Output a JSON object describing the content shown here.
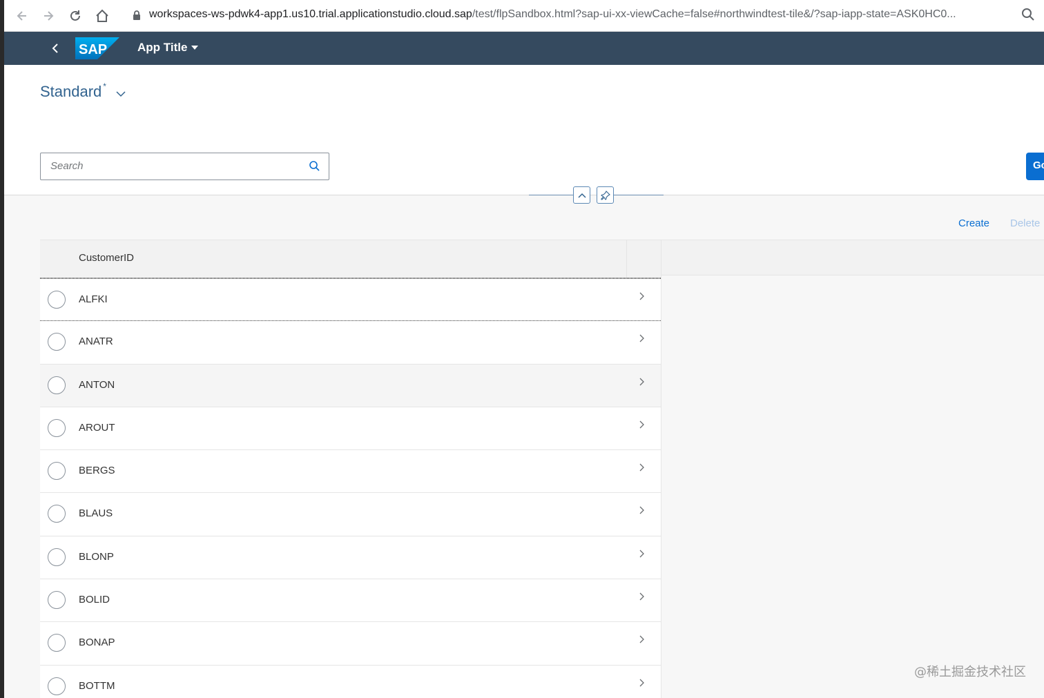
{
  "browser": {
    "url_host": "workspaces-ws-pdwk4-app1.us10.trial.applicationstudio.cloud.sap",
    "url_path": "/test/flpSandbox.html?sap-ui-xx-viewCache=false#northwindtest-tile&/?sap-iapp-state=ASK0HC0..."
  },
  "shell": {
    "logo_text": "SAP",
    "app_title": "App Title"
  },
  "header": {
    "variant_title": "Standard",
    "variant_modified": "*",
    "search_placeholder": "Search",
    "go_label": "Go"
  },
  "toolbar": {
    "create_label": "Create",
    "delete_label": "Delete"
  },
  "table": {
    "column_header": "CustomerID",
    "rows": [
      "ALFKI",
      "ANATR",
      "ANTON",
      "AROUT",
      "BERGS",
      "BLAUS",
      "BLONP",
      "BOLID",
      "BONAP",
      "BOTTM"
    ],
    "focused_row": "ALFKI",
    "hover_row": "ANTON"
  },
  "watermark": "@稀土掘金技术社区",
  "colors": {
    "shell_bg": "#354a5f",
    "accent": "#0a6ed1",
    "variant_title": "#32638f"
  }
}
